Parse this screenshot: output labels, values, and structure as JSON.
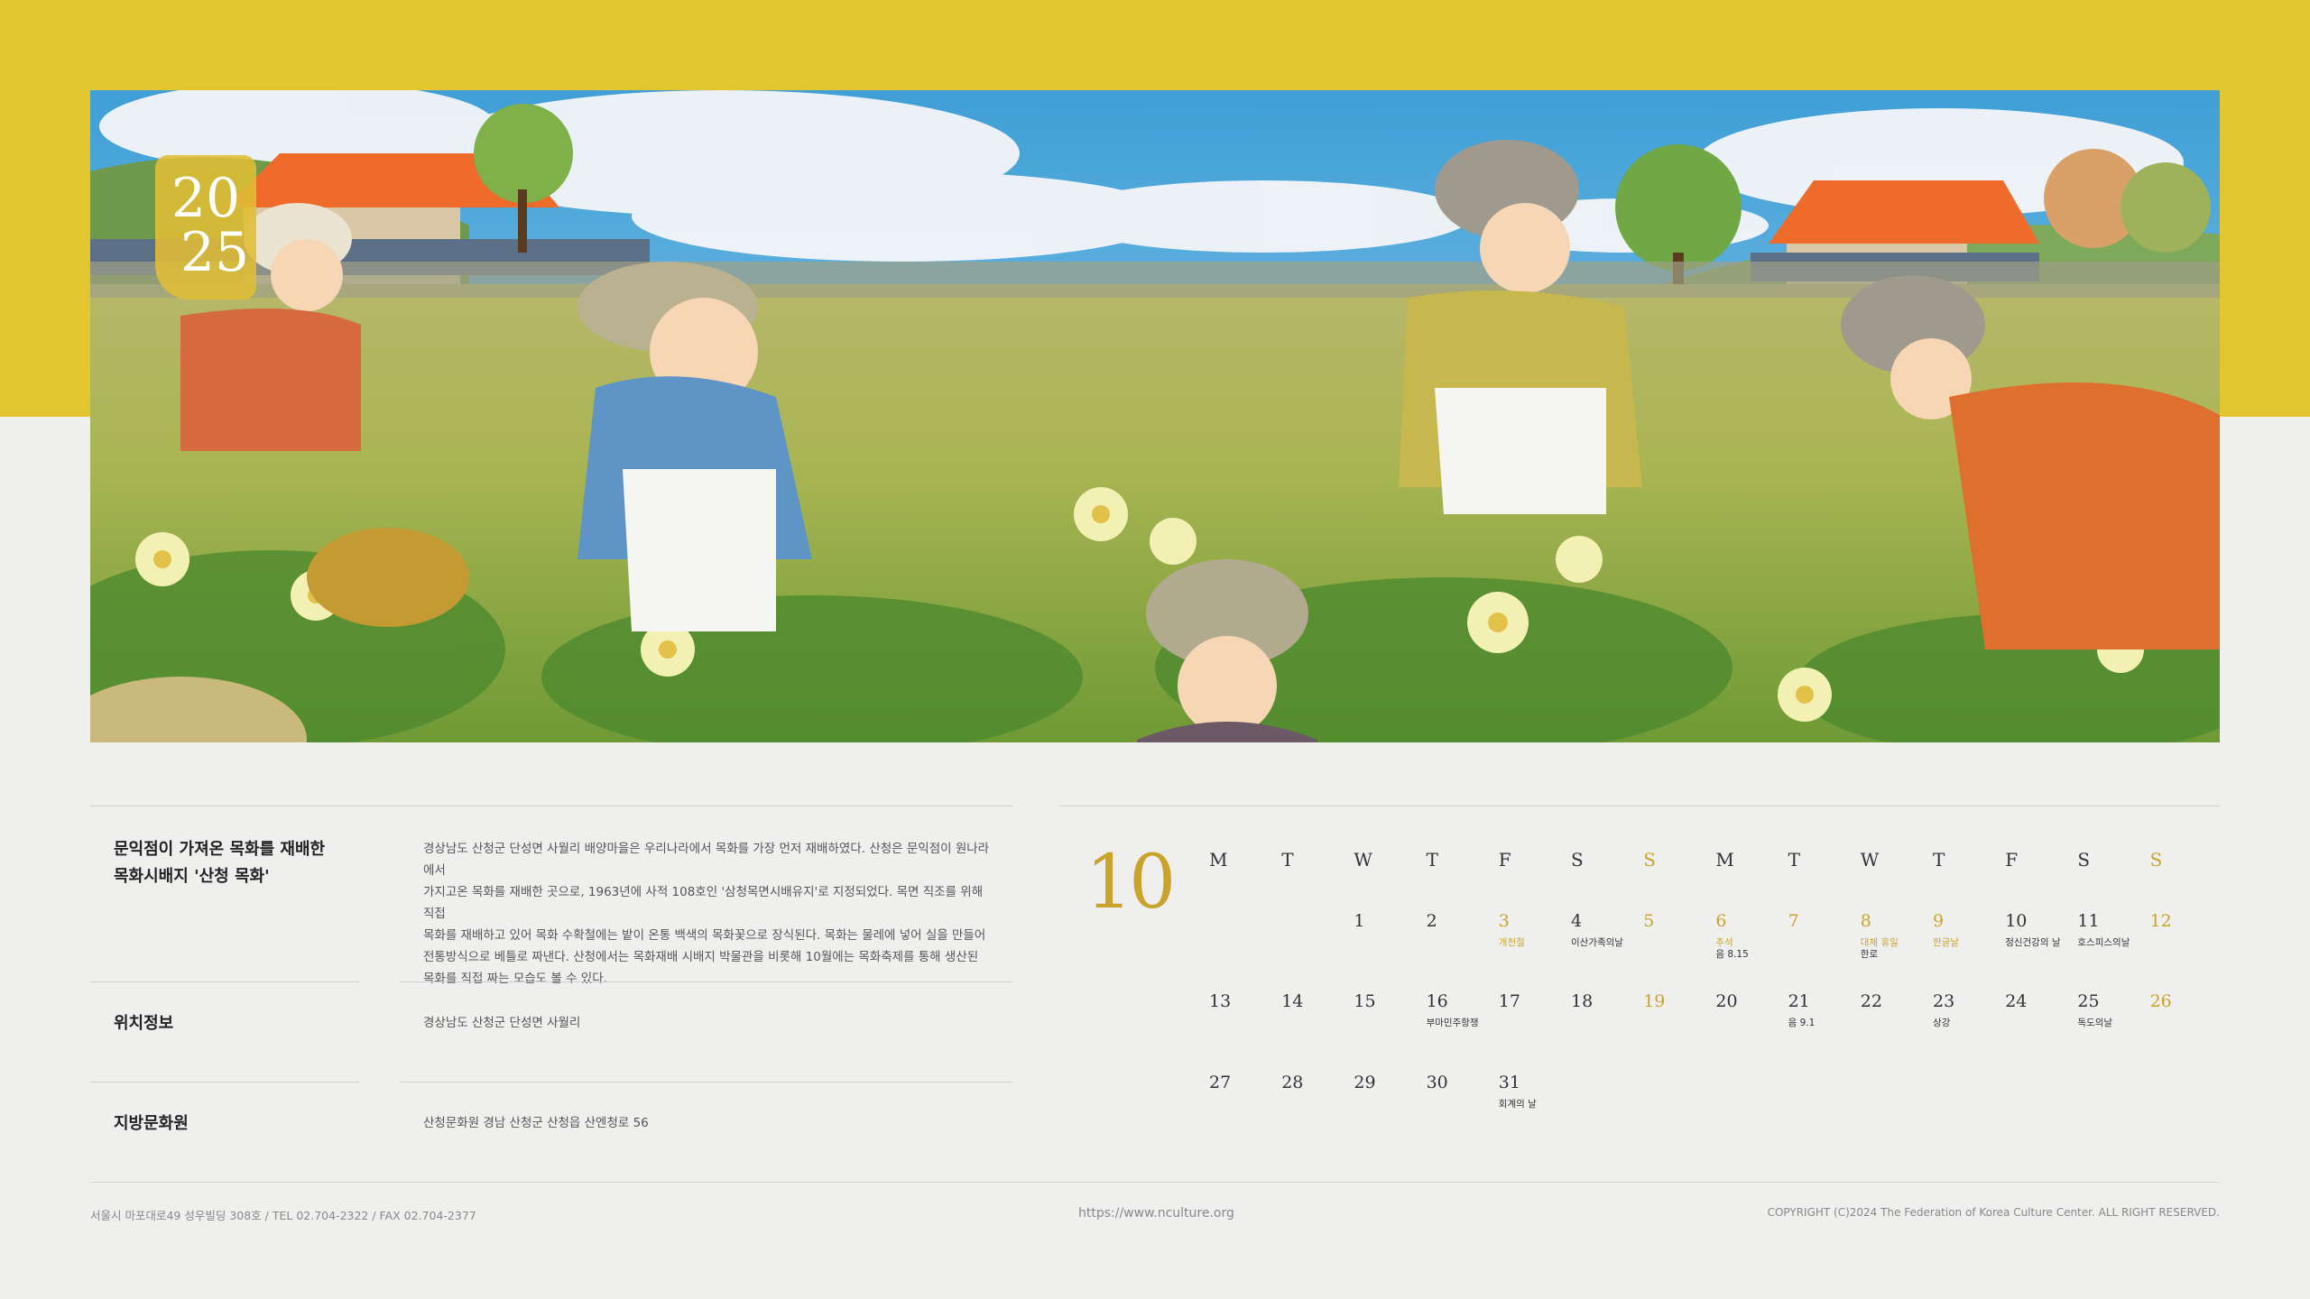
{
  "colors": {
    "accent": "#e3c62f",
    "gold": "#c9a42c",
    "background": "#efefee"
  },
  "hero": {
    "year_top": "20",
    "year_bottom": "25"
  },
  "info": {
    "title_line1": "문익점이 가져온 목화를 재배한",
    "title_line2": "목화시배지 '산청 목화'",
    "description": [
      "경상남도 산청군 단성면 사월리 배양마을은 우리나라에서 목화를 가장 먼저 재배하였다. 산청은 문익점이 원나라에서",
      "가지고온 목화를 재배한 곳으로, 1963년에 사적 108호인 '삼청목면시배유지'로 지정되었다. 목면 직조를 위해 직접",
      "목화를 재배하고 있어 목화 수확철에는 밭이 온통 백색의 목화꽃으로 장식된다. 목화는 물레에 넣어 실을 만들어",
      "전통방식으로 베틀로 짜낸다. 산청에서는 목화재배 시배지 박물관을 비롯해 10월에는 목화축제를 통해 생산된",
      "목화를 직접 짜는 모습도 볼 수 있다."
    ],
    "location_label": "위치정보",
    "location_value": "경상남도 산청군 단성면 사월리",
    "center_label": "지방문화원",
    "center_value": "산청문화원 경남 산청군 산청읍 산엔청로 56"
  },
  "calendar": {
    "month": "10",
    "weekdays": [
      {
        "d": "M"
      },
      {
        "d": "T"
      },
      {
        "d": "W"
      },
      {
        "d": "T"
      },
      {
        "d": "F"
      },
      {
        "d": "S"
      },
      {
        "d": "S",
        "hol": true
      },
      {
        "d": "M"
      },
      {
        "d": "T"
      },
      {
        "d": "W"
      },
      {
        "d": "T"
      },
      {
        "d": "F"
      },
      {
        "d": "S"
      },
      {
        "d": "S",
        "hol": true
      }
    ],
    "rows": [
      [
        {
          "col": 2,
          "day": "1"
        },
        {
          "col": 3,
          "day": "2"
        },
        {
          "col": 4,
          "day": "3",
          "hol": true,
          "notes": [
            {
              "t": "개천절",
              "hol": true
            }
          ]
        },
        {
          "col": 5,
          "day": "4",
          "notes": [
            {
              "t": "이산가족의날"
            }
          ]
        },
        {
          "col": 6,
          "day": "5",
          "hol": true
        },
        {
          "col": 7,
          "day": "6",
          "hol": true,
          "notes": [
            {
              "t": "추석",
              "hol": true
            },
            {
              "t": "음 8.15"
            }
          ]
        },
        {
          "col": 8,
          "day": "7",
          "hol": true
        },
        {
          "col": 9,
          "day": "8",
          "hol": true,
          "notes": [
            {
              "t": "대체 휴일",
              "hol": true
            },
            {
              "t": "한로"
            }
          ]
        },
        {
          "col": 10,
          "day": "9",
          "hol": true,
          "notes": [
            {
              "t": "한글날",
              "hol": true
            }
          ]
        },
        {
          "col": 11,
          "day": "10",
          "notes": [
            {
              "t": "정신건강의 날"
            }
          ]
        },
        {
          "col": 12,
          "day": "11",
          "notes": [
            {
              "t": "호스피스의날"
            }
          ]
        },
        {
          "col": 13,
          "day": "12",
          "hol": true
        }
      ],
      [
        {
          "col": 0,
          "day": "13"
        },
        {
          "col": 1,
          "day": "14"
        },
        {
          "col": 2,
          "day": "15"
        },
        {
          "col": 3,
          "day": "16",
          "notes": [
            {
              "t": "부마민주항쟁"
            }
          ]
        },
        {
          "col": 4,
          "day": "17"
        },
        {
          "col": 5,
          "day": "18"
        },
        {
          "col": 6,
          "day": "19",
          "hol": true
        },
        {
          "col": 7,
          "day": "20"
        },
        {
          "col": 8,
          "day": "21",
          "notes": [
            {
              "t": "음 9.1"
            }
          ]
        },
        {
          "col": 9,
          "day": "22"
        },
        {
          "col": 10,
          "day": "23",
          "notes": [
            {
              "t": "상강"
            }
          ]
        },
        {
          "col": 11,
          "day": "24"
        },
        {
          "col": 12,
          "day": "25",
          "notes": [
            {
              "t": "독도의날"
            }
          ]
        },
        {
          "col": 13,
          "day": "26",
          "hol": true
        }
      ],
      [
        {
          "col": 0,
          "day": "27"
        },
        {
          "col": 1,
          "day": "28"
        },
        {
          "col": 2,
          "day": "29"
        },
        {
          "col": 3,
          "day": "30"
        },
        {
          "col": 4,
          "day": "31",
          "notes": [
            {
              "t": "회계의 날"
            }
          ]
        }
      ]
    ]
  },
  "footer": {
    "address": "서울시 마포대로49 성우빌딩 308호  /  TEL  02.704-2322  /  FAX  02.704-2377",
    "url": "https://www.nculture.org",
    "copyright": "COPYRIGHT (C)2024 The Federation of Korea Culture Center. ALL RIGHT RESERVED."
  }
}
